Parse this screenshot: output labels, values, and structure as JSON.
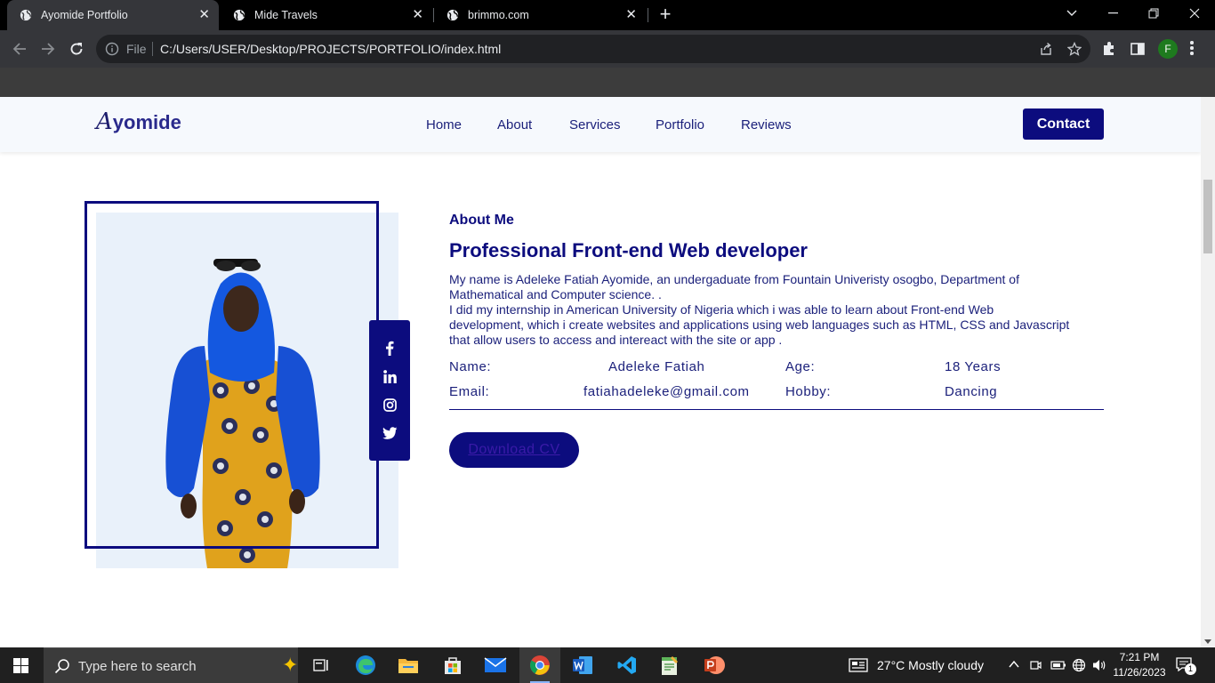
{
  "browser": {
    "tabs": [
      {
        "label": "Ayomide Portfolio",
        "active": true
      },
      {
        "label": "Mide Travels",
        "active": false
      },
      {
        "label": "brimmo.com",
        "active": false
      }
    ],
    "omnibox": {
      "scheme_label": "File",
      "url": "C:/Users/USER/Desktop/PROJECTS/PORTFOLIO/index.html"
    },
    "profile_initial": "F"
  },
  "site": {
    "logo": {
      "cap": "A",
      "rest": "yomide"
    },
    "nav": [
      "Home",
      "About",
      "Services",
      "Portfolio",
      "Reviews"
    ],
    "contact_label": "Contact",
    "about": {
      "subtitle": "About Me",
      "title": "Professional Front-end Web developer",
      "para1": "My name is Adeleke Fatiah Ayomide, an undergaduate from Fountain Univeristy osogbo, Department of Mathematical and Computer science. .",
      "para2": "I did my internship in American University of Nigeria which i was able to learn about Front-end Web development, which i create websites and applications using web languages such as HTML, CSS and Javascript that allow users to access and intereact with the site or app .",
      "info": {
        "name_label": "Name:",
        "name_value": "Adeleke Fatiah",
        "age_label": "Age:",
        "age_value": "18 Years",
        "email_label": "Email:",
        "email_value": "fatiahadeleke@gmail.com",
        "hobby_label": "Hobby:",
        "hobby_value": "Dancing"
      },
      "cv_label": "Download CV"
    },
    "social_icons": [
      "facebook-icon",
      "linkedin-icon",
      "instagram-icon",
      "twitter-icon"
    ],
    "colors": {
      "primary": "#0c0c7e",
      "header_bg": "#f6f9fd",
      "photo_bg": "#e9f1fa"
    }
  },
  "taskbar": {
    "search_placeholder": "Type here to search",
    "weather": "27°C  Mostly cloudy",
    "time": "7:21 PM",
    "date": "11/26/2023",
    "notification_count": "1"
  }
}
